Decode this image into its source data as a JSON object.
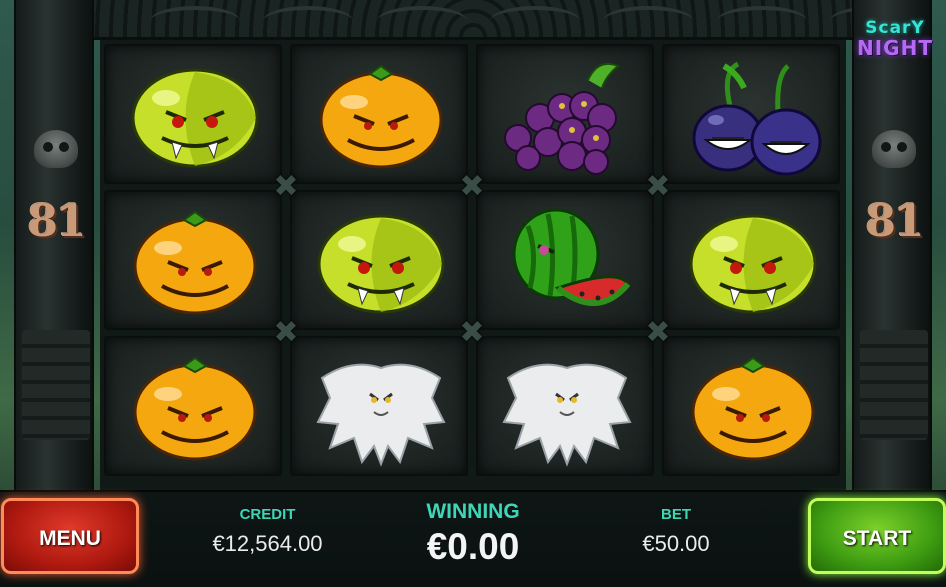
{
  "logo": {
    "line1": "ScarY",
    "line2": "NIGHT"
  },
  "side_numbers": {
    "left": "81",
    "right": "81"
  },
  "reels": [
    [
      "lemon",
      "orange",
      "grapes",
      "plums"
    ],
    [
      "orange",
      "lemon",
      "watermelon",
      "lemon"
    ],
    [
      "orange",
      "ghost",
      "ghost",
      "orange"
    ]
  ],
  "hud": {
    "credit_label": "CREDIT",
    "credit_value": "€12,564.00",
    "winning_label": "WINNING",
    "winning_value": "€0.00",
    "bet_label": "BET",
    "bet_value": "€50.00",
    "menu_label": "MENU",
    "start_label": "START"
  },
  "colors": {
    "menu_button": "#c2200f",
    "start_button": "#4aa614",
    "hud_label": "#3fd6b6",
    "side_number": "#c99a78"
  }
}
